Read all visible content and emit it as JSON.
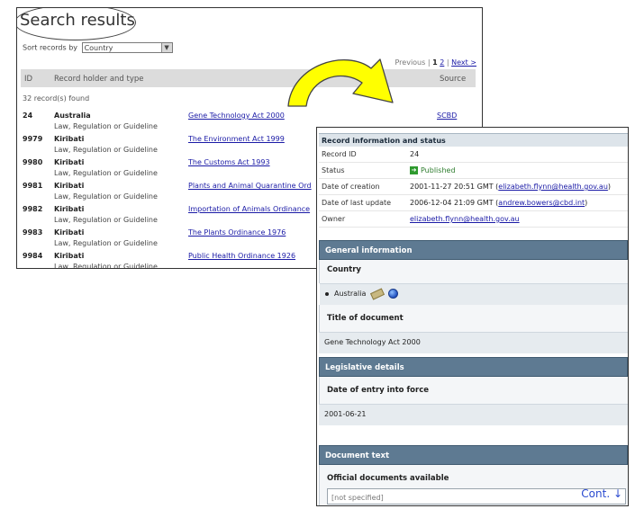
{
  "search": {
    "title": "Search results",
    "sort_label": "Sort records by",
    "sort_value": "Country",
    "pager": {
      "previous": "Previous",
      "sep1": "|",
      "current": "1",
      "page2": "2",
      "sep2": "|",
      "next": "Next >"
    },
    "columns": {
      "id": "ID",
      "holder": "Record holder and type",
      "source": "Source"
    },
    "found": "32 record(s) found",
    "rows": [
      {
        "id": "24",
        "holder": "Australia",
        "type": "Law, Regulation or Guideline",
        "title": "Gene Technology Act 2000",
        "source": "SCBD"
      },
      {
        "id": "9979",
        "holder": "Kiribati",
        "type": "Law, Regulation or Guideline",
        "title": "The Environment Act 1999",
        "source": ""
      },
      {
        "id": "9980",
        "holder": "Kiribati",
        "type": "Law, Regulation or Guideline",
        "title": "The Customs Act 1993",
        "source": ""
      },
      {
        "id": "9981",
        "holder": "Kiribati",
        "type": "Law, Regulation or Guideline",
        "title": "Plants and Animal Quarantine Ord",
        "source": ""
      },
      {
        "id": "9982",
        "holder": "Kiribati",
        "type": "Law, Regulation or Guideline",
        "title": "Importation of Animals Ordinance",
        "source": ""
      },
      {
        "id": "9983",
        "holder": "Kiribati",
        "type": "Law, Regulation or Guideline",
        "title": "The Plants Ordinance 1976",
        "source": ""
      },
      {
        "id": "9984",
        "holder": "Kiribati",
        "type": "Law, Regulation or Guideline",
        "title": "Public Health Ordinance 1926",
        "source": ""
      }
    ]
  },
  "detail": {
    "record_header": "Record information and status",
    "fields": {
      "record_id_label": "Record ID",
      "record_id": "24",
      "status_label": "Status",
      "status": "Published",
      "creation_label": "Date of creation",
      "creation_date": "2001-11-27 20:51 GMT (",
      "creation_email": "elizabeth.flynn@health.gov.au",
      "creation_close": ")",
      "update_label": "Date of last update",
      "update_date": "2006-12-04 21:09 GMT (",
      "update_email": "andrew.bowers@cbd.int",
      "update_close": ")",
      "owner_label": "Owner",
      "owner_email": "elizabeth.flynn@health.gov.au"
    },
    "general_header": "General information",
    "country_label": "Country",
    "country_value": "Australia",
    "doc_title_label": "Title of document",
    "doc_title_value": "Gene Technology Act 2000",
    "legislative_header": "Legislative details",
    "entry_label": "Date of entry into force",
    "entry_value": "2001-06-21",
    "doctext_header": "Document text",
    "official_label": "Official documents available",
    "official_value": "[not specified]",
    "cont_label": "Cont. ↓"
  },
  "colors": {
    "section_dark": "#5e7a92",
    "arrow_fill": "#ffff00",
    "link": "#1a1aa6",
    "published": "#2e7d2e"
  }
}
